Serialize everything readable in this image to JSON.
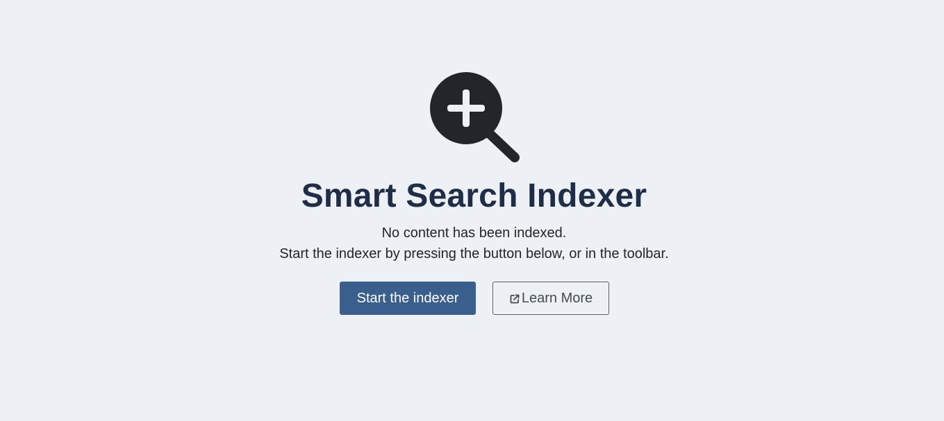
{
  "title": "Smart Search Indexer",
  "message": {
    "line1": "No content has been indexed.",
    "line2": "Start the indexer by pressing the button below, or in the toolbar."
  },
  "buttons": {
    "primary_label": "Start the indexer",
    "secondary_label": "Learn More"
  },
  "icons": {
    "hero": "search-plus-icon",
    "learn_more": "external-link-icon"
  },
  "colors": {
    "background": "#edf1f6",
    "title": "#1f2d46",
    "primary_button": "#3b5f8d",
    "icon": "#22262a"
  }
}
